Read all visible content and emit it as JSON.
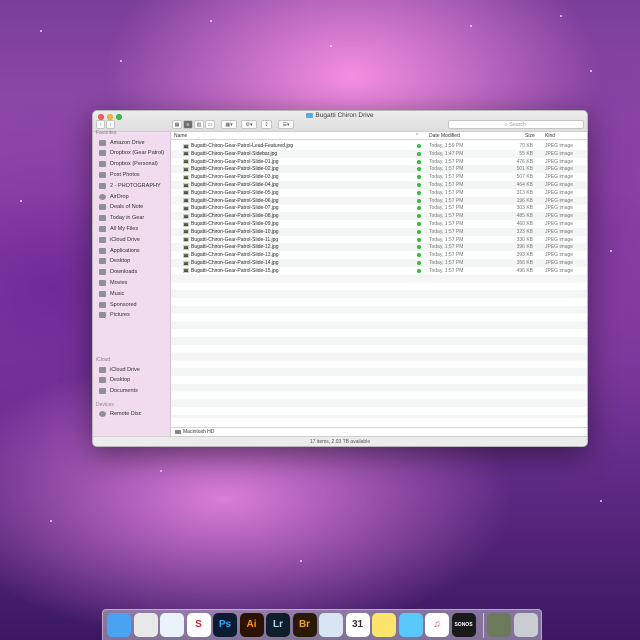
{
  "window": {
    "title": "Bugatti Chiron Drive",
    "search_placeholder": "Search",
    "status": "17 items, 2.03 TB available",
    "path": "Macintosh HD"
  },
  "sidebar": {
    "favorites_heading": "Favorites",
    "favorites": [
      {
        "label": "Amazon Drive",
        "icon": "folder-icon"
      },
      {
        "label": "Dropbox (Gear Patrol)",
        "icon": "dropbox-icon"
      },
      {
        "label": "Dropbox (Personal)",
        "icon": "dropbox-icon"
      },
      {
        "label": "Post Photos",
        "icon": "folder-icon"
      },
      {
        "label": "2 - PHOTOGRAPHY",
        "icon": "folder-icon"
      },
      {
        "label": "AirDrop",
        "icon": "airdrop-icon"
      },
      {
        "label": "Deals of Note",
        "icon": "folder-icon"
      },
      {
        "label": "Today in Gear",
        "icon": "folder-icon"
      },
      {
        "label": "All My Files",
        "icon": "files-icon"
      },
      {
        "label": "iCloud Drive",
        "icon": "cloud-icon"
      },
      {
        "label": "Applications",
        "icon": "applications-icon"
      },
      {
        "label": "Desktop",
        "icon": "desktop-icon"
      },
      {
        "label": "Downloads",
        "icon": "downloads-icon"
      },
      {
        "label": "Movies",
        "icon": "movies-icon"
      },
      {
        "label": "Music",
        "icon": "music-icon"
      },
      {
        "label": "Sponsored",
        "icon": "folder-icon"
      },
      {
        "label": "Pictures",
        "icon": "pictures-icon"
      }
    ],
    "icloud_heading": "iCloud",
    "icloud": [
      {
        "label": "iCloud Drive",
        "icon": "cloud-icon"
      },
      {
        "label": "Desktop",
        "icon": "desktop-icon"
      },
      {
        "label": "Documents",
        "icon": "documents-icon"
      }
    ],
    "devices_heading": "Devices",
    "devices": [
      {
        "label": "Remote Disc",
        "icon": "disc-icon"
      }
    ]
  },
  "columns": {
    "name": "Name",
    "date": "Date Modified",
    "size": "Size",
    "kind": "Kind"
  },
  "files": [
    {
      "name": "Bugatti-Chiron-Gear-Patrol-Lead-Featured.jpg",
      "date": "Today, 1:59 PM",
      "size": "70 KB",
      "kind": "JPEG image"
    },
    {
      "name": "Bugatti-Chiron-Gear-Patrol-Sidebar.jpg",
      "date": "Today, 1:47 PM",
      "size": "55 KB",
      "kind": "JPEG image"
    },
    {
      "name": "Bugatti-Chiron-Gear-Patrol-Slide-01.jpg",
      "date": "Today, 1:57 PM",
      "size": "476 KB",
      "kind": "JPEG image"
    },
    {
      "name": "Bugatti-Chiron-Gear-Patrol-Slide-02.jpg",
      "date": "Today, 1:57 PM",
      "size": "501 KB",
      "kind": "JPEG image"
    },
    {
      "name": "Bugatti-Chiron-Gear-Patrol-Slide-03.jpg",
      "date": "Today, 1:57 PM",
      "size": "507 KB",
      "kind": "JPEG image"
    },
    {
      "name": "Bugatti-Chiron-Gear-Patrol-Slide-04.jpg",
      "date": "Today, 1:57 PM",
      "size": "464 KB",
      "kind": "JPEG image"
    },
    {
      "name": "Bugatti-Chiron-Gear-Patrol-Slide-05.jpg",
      "date": "Today, 1:57 PM",
      "size": "313 KB",
      "kind": "JPEG image"
    },
    {
      "name": "Bugatti-Chiron-Gear-Patrol-Slide-06.jpg",
      "date": "Today, 1:57 PM",
      "size": "196 KB",
      "kind": "JPEG image"
    },
    {
      "name": "Bugatti-Chiron-Gear-Patrol-Slide-07.jpg",
      "date": "Today, 1:57 PM",
      "size": "303 KB",
      "kind": "JPEG image"
    },
    {
      "name": "Bugatti-Chiron-Gear-Patrol-Slide-08.jpg",
      "date": "Today, 1:57 PM",
      "size": "485 KB",
      "kind": "JPEG image"
    },
    {
      "name": "Bugatti-Chiron-Gear-Patrol-Slide-09.jpg",
      "date": "Today, 1:57 PM",
      "size": "460 KB",
      "kind": "JPEG image"
    },
    {
      "name": "Bugatti-Chiron-Gear-Patrol-Slide-10.jpg",
      "date": "Today, 1:57 PM",
      "size": "323 KB",
      "kind": "JPEG image"
    },
    {
      "name": "Bugatti-Chiron-Gear-Patrol-Slide-11.jpg",
      "date": "Today, 1:57 PM",
      "size": "330 KB",
      "kind": "JPEG image"
    },
    {
      "name": "Bugatti-Chiron-Gear-Patrol-Slide-12.jpg",
      "date": "Today, 1:57 PM",
      "size": "396 KB",
      "kind": "JPEG image"
    },
    {
      "name": "Bugatti-Chiron-Gear-Patrol-Slide-13.jpg",
      "date": "Today, 1:57 PM",
      "size": "393 KB",
      "kind": "JPEG image"
    },
    {
      "name": "Bugatti-Chiron-Gear-Patrol-Slide-14.jpg",
      "date": "Today, 1:57 PM",
      "size": "356 KB",
      "kind": "JPEG image"
    },
    {
      "name": "Bugatti-Chiron-Gear-Patrol-Slide-15.jpg",
      "date": "Today, 1:57 PM",
      "size": "496 KB",
      "kind": "JPEG image"
    }
  ],
  "dock": {
    "apps": [
      {
        "name": "finder-icon",
        "label": "",
        "bg": "#4aa3f0",
        "fg": "#ffffff"
      },
      {
        "name": "chrome-icon",
        "label": "",
        "bg": "#e8e8e8",
        "fg": "#db4437"
      },
      {
        "name": "safari-icon",
        "label": "",
        "bg": "#eaf3fb",
        "fg": "#2d8fe6"
      },
      {
        "name": "sketchbook-icon",
        "label": "S",
        "bg": "#ffffff",
        "fg": "#d9232a"
      },
      {
        "name": "photoshop-icon",
        "label": "Ps",
        "bg": "#0c1b2f",
        "fg": "#31a8ff"
      },
      {
        "name": "illustrator-icon",
        "label": "Ai",
        "bg": "#2c1200",
        "fg": "#ff9a00"
      },
      {
        "name": "lightroom-icon",
        "label": "Lr",
        "bg": "#0f1e2b",
        "fg": "#add5ec"
      },
      {
        "name": "bridge-icon",
        "label": "Br",
        "bg": "#2a1a05",
        "fg": "#e8a13a"
      },
      {
        "name": "preview-icon",
        "label": "",
        "bg": "#d8e6f3",
        "fg": "#3a6ea5"
      },
      {
        "name": "calendar-icon",
        "label": "31",
        "bg": "#ffffff",
        "fg": "#333333"
      },
      {
        "name": "notes-icon",
        "label": "",
        "bg": "#fbe46b",
        "fg": "#8a7a20"
      },
      {
        "name": "messages-icon",
        "label": "",
        "bg": "#5ac8fa",
        "fg": "#ffffff"
      },
      {
        "name": "itunes-icon",
        "label": "♫",
        "bg": "#ffffff",
        "fg": "#e0397a"
      },
      {
        "name": "sonos-icon",
        "label": "SONOS",
        "bg": "#1a1a1a",
        "fg": "#ffffff"
      },
      {
        "name": "image-capture-icon",
        "label": "",
        "bg": "#6c7a5c",
        "fg": "#ffffff"
      },
      {
        "name": "trash-icon",
        "label": "",
        "bg": "#c9ccd0",
        "fg": "#888888"
      }
    ]
  }
}
